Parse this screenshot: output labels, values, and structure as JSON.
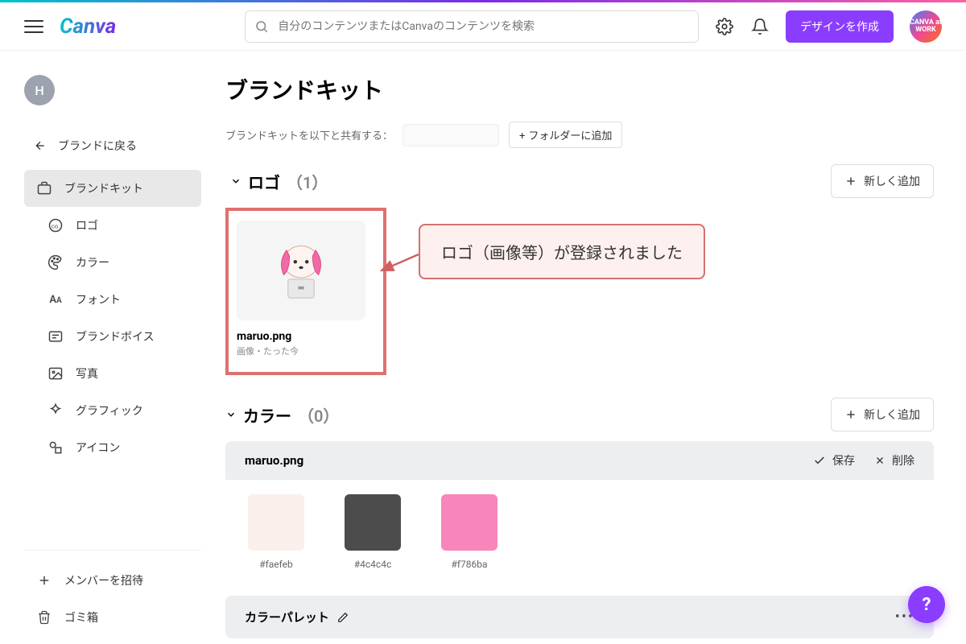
{
  "topbar": {
    "logo": "Canva",
    "search_placeholder": "自分のコンテンツまたはCanvaのコンテンツを検索",
    "create_label": "デザインを作成",
    "badge_text": "CANVA at WORK"
  },
  "sidebar": {
    "avatar_initial": "H",
    "back_label": "ブランドに戻る",
    "items": [
      {
        "label": "ブランドキット",
        "active": true
      },
      {
        "label": "ロゴ",
        "sub": true
      },
      {
        "label": "カラー",
        "sub": true
      },
      {
        "label": "フォント",
        "sub": true
      },
      {
        "label": "ブランドボイス",
        "sub": true
      },
      {
        "label": "写真",
        "sub": true
      },
      {
        "label": "グラフィック",
        "sub": true
      },
      {
        "label": "アイコン",
        "sub": true
      }
    ],
    "invite_label": "メンバーを招待",
    "trash_label": "ゴミ箱"
  },
  "main": {
    "title": "ブランドキット",
    "share_label": "ブランドキットを以下と共有する：",
    "add_folder_label": "フォルダーに追加",
    "logo_section": {
      "heading": "ロゴ",
      "count": "（1）",
      "add_label": "新しく追加",
      "item": {
        "name": "maruo.png",
        "meta": "画像・たった今"
      }
    },
    "annotation_text": "ロゴ（画像等）が登録されました",
    "color_section": {
      "heading": "カラー",
      "count": "（0）",
      "add_label": "新しく追加",
      "palette_name": "maruo.png",
      "save_label": "保存",
      "delete_label": "削除",
      "swatches": [
        {
          "hex": "#faefeb",
          "label": "#faefeb"
        },
        {
          "hex": "#4c4c4c",
          "label": "#4c4c4c"
        },
        {
          "hex": "#f786ba",
          "label": "#f786ba"
        }
      ],
      "palette2_name": "カラーパレット"
    }
  },
  "help_label": "?"
}
